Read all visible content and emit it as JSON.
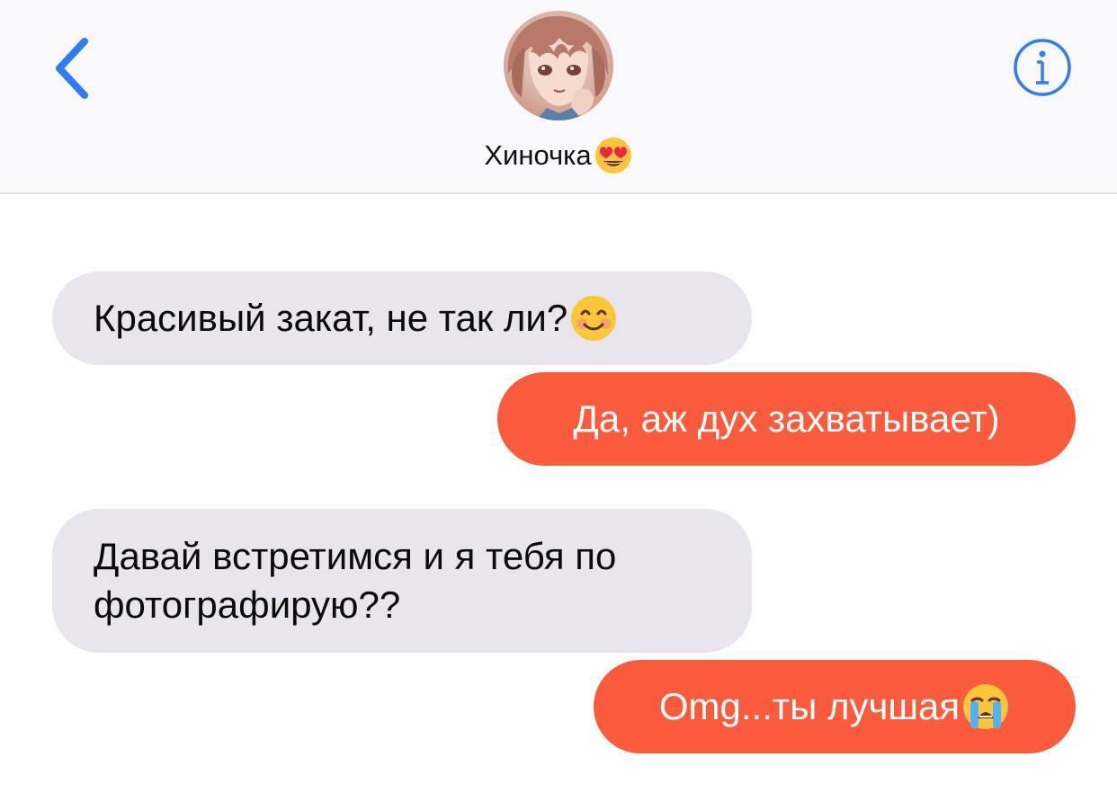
{
  "header": {
    "contact_name": "Хиночка",
    "contact_name_emoji": "heart-eyes-emoji",
    "back_icon": "chevron-left-icon",
    "info_icon": "info-icon",
    "avatar": "contact-avatar"
  },
  "messages": [
    {
      "direction": "incoming",
      "text": "Красивый закат, не так ли?",
      "emoji": "smiling-face-emoji"
    },
    {
      "direction": "outgoing",
      "text": "Да, аж дух захватывает)"
    },
    {
      "direction": "incoming",
      "text": "Давай встретимся и я тебя по фотографирую??"
    },
    {
      "direction": "outgoing",
      "text": "Omg...ты лучшая",
      "emoji": "crying-face-emoji"
    }
  ],
  "colors": {
    "accent": "#2f7cf6",
    "outgoing_bubble": "#fb5b3d",
    "incoming_bubble": "#e8e6ec",
    "header_bg": "#f9f8fa"
  }
}
